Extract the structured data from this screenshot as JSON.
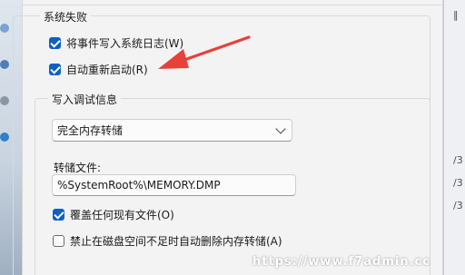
{
  "dialog": {
    "system_failure_group": {
      "title": "系统失败",
      "write_event_log": {
        "label": "将事件写入系统日志(W)",
        "checked": true
      },
      "auto_restart": {
        "label": "自动重新启动(R)",
        "checked": true
      }
    },
    "debug_info_group": {
      "title": "写入调试信息",
      "dump_type": {
        "selected": "完全内存转储"
      },
      "dump_file_label": "转储文件:",
      "dump_file_value": "%SystemRoot%\\MEMORY.DMP",
      "overwrite": {
        "label": "覆盖任何现有文件(O)",
        "checked": true
      },
      "disable_auto_delete": {
        "label": "禁止在磁盘空间不足时自动删除内存转储(A)",
        "checked": false
      }
    }
  },
  "right_edge_fragments": [
    "‖",
    "/3",
    "/3",
    "/3"
  ],
  "colors": {
    "checkbox_accent": "#0b61c2",
    "annotation_arrow": "#e8413a",
    "dialog_bg": "#f3f3f3"
  },
  "watermark": "https://www.f7admin.cc"
}
